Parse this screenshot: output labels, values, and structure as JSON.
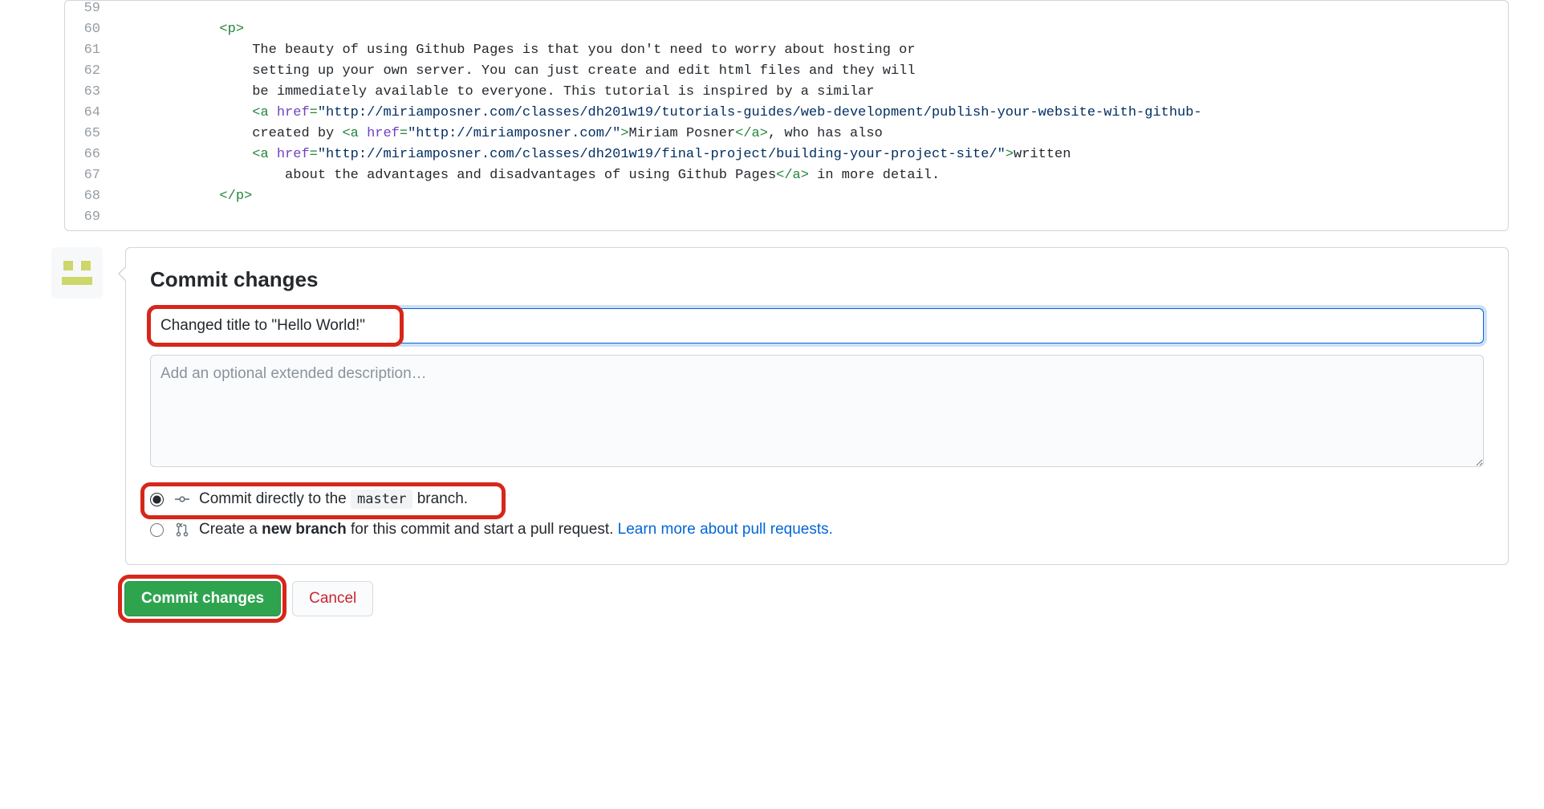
{
  "code": {
    "lines": [
      {
        "num": "59",
        "indent": ""
      },
      {
        "num": "60",
        "indent": "            ",
        "tag_open": "<p>"
      },
      {
        "num": "61",
        "indent": "                ",
        "text": "The beauty of using Github Pages is that you don't need to worry about hosting or"
      },
      {
        "num": "62",
        "indent": "                ",
        "text": "setting up your own server. You can just create and edit html files and they will"
      },
      {
        "num": "63",
        "indent": "                ",
        "text": "be immediately available to everyone. This tutorial is inspired by a similar"
      },
      {
        "num": "64",
        "indent": "                ",
        "tag_name": "a",
        "attr": "href",
        "attr_val": "\"http://miriamposner.com/classes/dh201w19/tutorials-guides/web-development/publish-your-website-with-github-",
        "prefix": "<",
        "eq": "="
      },
      {
        "num": "65",
        "indent": "                ",
        "pre_text": "created by ",
        "tag_name": "a",
        "attr": "href",
        "attr_val": "\"http://miriamposner.com/\"",
        "close_angle": ">",
        "link_text": "Miriam Posner",
        "close_tag": "</a>",
        "post_text": ", who has also"
      },
      {
        "num": "66",
        "indent": "                ",
        "tag_name": "a",
        "attr": "href",
        "attr_val": "\"http://miriamposner.com/classes/dh201w19/final-project/building-your-project-site/\"",
        "close_angle": ">",
        "link_text": "written"
      },
      {
        "num": "67",
        "indent": "                    ",
        "text": "about the advantages and disadvantages of using Github Pages",
        "close_tag": "</a>",
        "post_text": " in more detail."
      },
      {
        "num": "68",
        "indent": "            ",
        "tag_close": "</p>"
      },
      {
        "num": "69",
        "indent": ""
      }
    ]
  },
  "commit": {
    "heading": "Commit changes",
    "summary_value": "Changed title to \"Hello World!\"",
    "description_placeholder": "Add an optional extended description…",
    "radio_direct_pre": "Commit directly to the ",
    "radio_direct_branch": "master",
    "radio_direct_post": " branch.",
    "radio_new_pre": "Create a ",
    "radio_new_bold": "new branch",
    "radio_new_post": " for this commit and start a pull request. ",
    "radio_new_link": "Learn more about pull requests.",
    "btn_commit": "Commit changes",
    "btn_cancel": "Cancel"
  }
}
